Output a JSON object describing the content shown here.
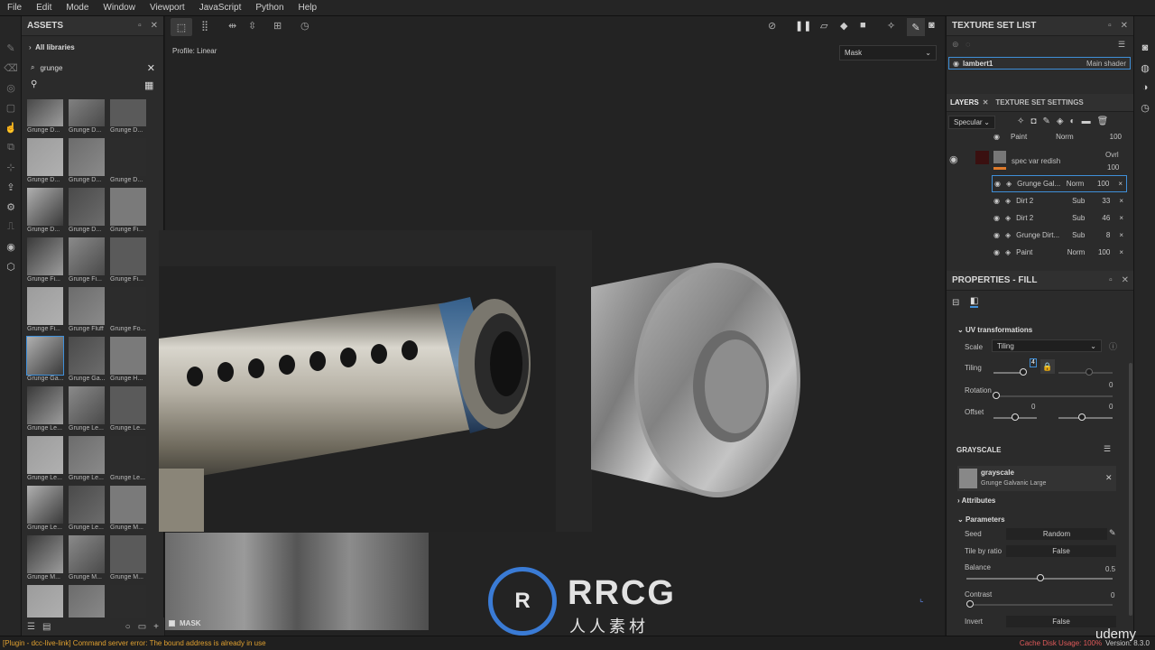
{
  "menu": [
    "File",
    "Edit",
    "Mode",
    "Window",
    "Viewport",
    "JavaScript",
    "Python",
    "Help"
  ],
  "assets": {
    "title": "ASSETS",
    "libraries": "All libraries",
    "search_value": "grunge",
    "thumbs": [
      "Grunge D...",
      "Grunge D...",
      "Grunge D...",
      "Grunge D...",
      "Grunge D...",
      "Grunge D...",
      "Grunge D...",
      "Grunge D...",
      "Grunge Fi...",
      "Grunge Fi...",
      "Grunge Fi...",
      "Grunge Fi...",
      "Grunge Fi...",
      "Grunge Fluff",
      "Grunge Fo...",
      "Grunge Ga...",
      "Grunge Ga...",
      "Grunge H...",
      "Grunge Le...",
      "Grunge Le...",
      "Grunge Le...",
      "Grunge Le...",
      "Grunge Le...",
      "Grunge Le...",
      "Grunge Le...",
      "Grunge Le...",
      "Grunge M...",
      "Grunge M...",
      "Grunge M...",
      "Grunge M...",
      "",
      "",
      ""
    ],
    "selected_index": 15
  },
  "viewport": {
    "profile": "Profile: Linear",
    "mode_select": "Mask",
    "mask_label": "MASK"
  },
  "texture_set_list": {
    "title": "TEXTURE SET LIST",
    "item_name": "lambert1",
    "item_shader": "Main shader"
  },
  "layers": {
    "tab_layers": "LAYERS",
    "tab_tss": "TEXTURE SET SETTINGS",
    "channel": "Specular",
    "partial_top": {
      "name": "Paint",
      "blend": "Norm",
      "opacity": "100"
    },
    "group": {
      "name": "spec var redish",
      "blend": "Ovrl",
      "opacity": "100"
    },
    "rows": [
      {
        "name": "Grunge Gal...",
        "blend": "Norm",
        "opacity": "100",
        "selected": true
      },
      {
        "name": "Dirt 2",
        "blend": "Sub",
        "opacity": "33"
      },
      {
        "name": "Dirt 2",
        "blend": "Sub",
        "opacity": "46"
      },
      {
        "name": "Grunge Dirt...",
        "blend": "Sub",
        "opacity": "8"
      },
      {
        "name": "Paint",
        "blend": "Norm",
        "opacity": "100"
      }
    ]
  },
  "properties": {
    "title": "PROPERTIES - FILL",
    "uv_title": "UV transformations",
    "scale_label": "Scale",
    "scale_value": "Tiling",
    "tiling_label": "Tiling",
    "tiling_value": "4",
    "rotation_label": "Rotation",
    "rotation_value": "0",
    "offset_label": "Offset",
    "offset_u": "0",
    "offset_v": "0",
    "grayscale_title": "GRAYSCALE",
    "grayscale_name": "grayscale",
    "grayscale_resource": "Grunge Galvanic Large",
    "attributes": "Attributes",
    "parameters": "Parameters",
    "seed_label": "Seed",
    "seed_value": "Random",
    "tile_label": "Tile by ratio",
    "tile_value": "False",
    "balance_label": "Balance",
    "balance_value": "0.5",
    "contrast_label": "Contrast",
    "contrast_value": "0",
    "invert_label": "Invert",
    "invert_value": "False"
  },
  "status": {
    "message": "[Plugin - dcc-live-link] Command server error: The bound address is already in use",
    "cache": "Cache Disk Usage: 100%",
    "version": "Version: 8.3.0"
  },
  "watermark": {
    "brand": "RRCG",
    "sub": "人人素材",
    "udemy": "udemy"
  },
  "colors": {
    "accent": "#3f8fd8",
    "warning": "#e0a030",
    "error": "#e05a5a"
  }
}
